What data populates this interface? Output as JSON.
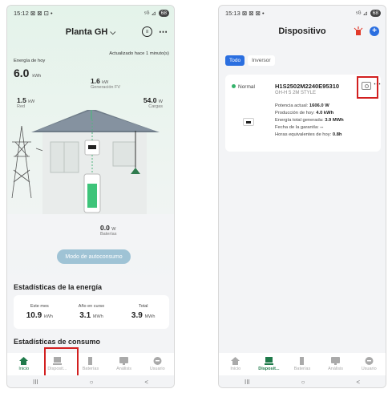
{
  "left": {
    "status_time": "15:12",
    "status_icons": "⊠ ⊠ ⊡ •",
    "status_right": "⁵ᴳ ⊿",
    "battery": "68",
    "plant_name": "Planta GH",
    "updated": "Actualizado hace 1 minuto(s)",
    "energy_today_label": "Energía de hoy",
    "energy_today_value": "6.0",
    "energy_today_unit": "kWh",
    "pv_value": "1.6",
    "pv_unit": "kW",
    "pv_label": "Generación FV",
    "grid_value": "1.5",
    "grid_unit": "kW",
    "grid_label": "Red",
    "load_value": "54.0",
    "load_unit": "W",
    "load_label": "Cargas",
    "battery_value": "0.0",
    "battery_unit": "W",
    "battery_label": "Baterías",
    "mode_button": "Modo de autoconsumo",
    "energy_stats_title": "Estadísticas de la energía",
    "stats": [
      {
        "label": "Este mes",
        "value": "10.9",
        "unit": "kWh"
      },
      {
        "label": "Año en curso",
        "value": "3.1",
        "unit": "MWh"
      },
      {
        "label": "Total",
        "value": "3.9",
        "unit": "MWh"
      }
    ],
    "consumption_title": "Estadísticas de consumo"
  },
  "tabs": [
    {
      "label": "Inicio",
      "icon": "home-icon"
    },
    {
      "label": "Disposit...",
      "icon": "device-icon"
    },
    {
      "label": "Baterías",
      "icon": "battery-icon"
    },
    {
      "label": "Análisis",
      "icon": "analysis-icon"
    },
    {
      "label": "Usuario",
      "icon": "user-icon"
    }
  ],
  "nav": {
    "recent": "III",
    "home": "○",
    "back": "<"
  },
  "right": {
    "status_time": "15:13",
    "status_icons": "⊠ ⊠ ⊠ •",
    "status_right": "⁵ᴳ ⊿",
    "battery": "68",
    "title": "Dispositivo",
    "filters": [
      "Todo",
      "Inversor"
    ],
    "device": {
      "status": "Normal",
      "serial": "H1S2502M2240E95310",
      "model": "GH-H 5 2M STYLE",
      "rows": [
        {
          "label": "Potencia actual: ",
          "value": "1606.0 W"
        },
        {
          "label": "Producción de hoy: ",
          "value": "4.0 kWh"
        },
        {
          "label": "Energía total generada: ",
          "value": "3.9 MWh"
        },
        {
          "label": "Fecha de la garantía: ",
          "value": "--"
        },
        {
          "label": "Horas equivalentes de hoy: ",
          "value": "0.8h"
        }
      ]
    }
  },
  "colors": {
    "accent_green": "#1f7a4a",
    "accent_blue": "#2b6fe0",
    "highlight_red": "#d21f1f",
    "alarm_red": "#e23a2a"
  }
}
